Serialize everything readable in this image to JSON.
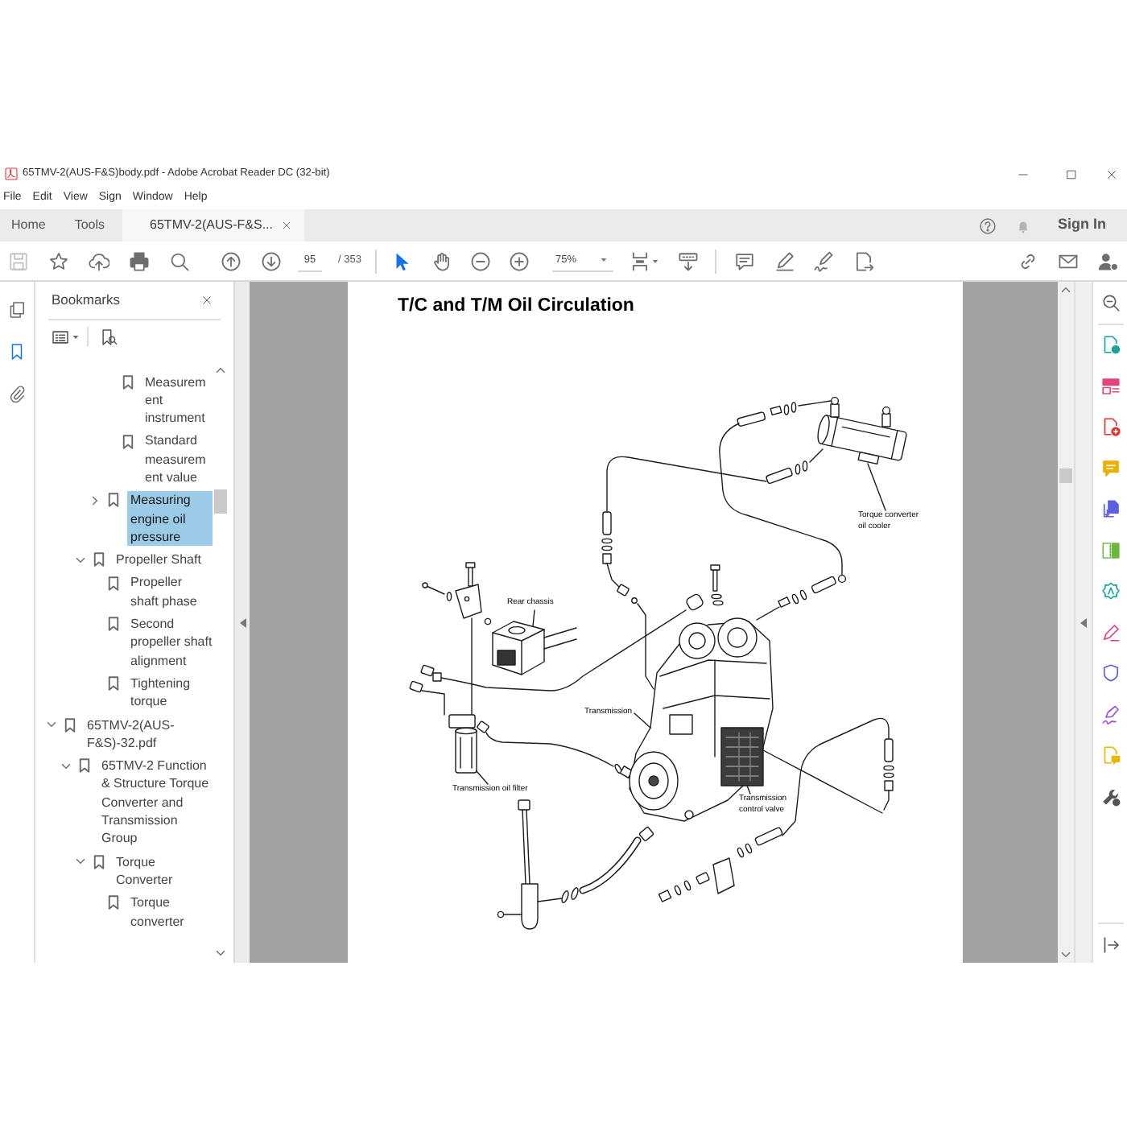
{
  "window": {
    "title": "65TMV-2(AUS-F&S)body.pdf - Adobe Acrobat Reader DC (32-bit)"
  },
  "menu": [
    "File",
    "Edit",
    "View",
    "Sign",
    "Window",
    "Help"
  ],
  "tabs": [
    {
      "label": "Home",
      "selected": false,
      "closable": false
    },
    {
      "label": "Tools",
      "selected": false,
      "closable": false
    },
    {
      "label": "65TMV-2(AUS-F&S...",
      "selected": true,
      "closable": true
    }
  ],
  "header_actions": {
    "sign_in": "Sign In"
  },
  "toolbar": {
    "save_button": {
      "disabled": true
    },
    "page_field": "95",
    "page_count": "/ 353",
    "tools": [
      {
        "kind": "select",
        "selected": true
      },
      {
        "kind": "hand",
        "selected": false
      }
    ],
    "zoom_field": "75%"
  },
  "left_rail": [
    {
      "kind": "pages",
      "selected": false
    },
    {
      "kind": "bookmarks",
      "selected": true
    },
    {
      "kind": "attachments",
      "selected": false
    }
  ],
  "bookmarks_panel": {
    "title": "Bookmarks",
    "tree": [
      {
        "children": [
          {
            "children": [
              {
                "children": [
                  {
                    "children": [
                      {
                        "label": "Measurement instrument",
                        "kind": "leaf",
                        "selected": false
                      },
                      {
                        "label": "Standard measurement value",
                        "kind": "leaf",
                        "selected": false
                      }
                    ]
                  },
                  {
                    "label": "Measuring engine oil pressure",
                    "kind": "branch",
                    "expanded": false,
                    "selected": true
                  }
                ]
              },
              {
                "label": "Propeller Shaft",
                "kind": "branch",
                "expanded": true,
                "selected": false,
                "children": [
                  {
                    "label": "Propeller shaft phase",
                    "kind": "leaf",
                    "selected": false
                  },
                  {
                    "label": "Second propeller shaft alignment",
                    "kind": "leaf",
                    "selected": false
                  },
                  {
                    "label": "Tightening torque",
                    "kind": "leaf",
                    "selected": false
                  }
                ]
              }
            ]
          }
        ]
      },
      {
        "label": "65TMV-2(AUS-F&S)-32.pdf",
        "kind": "branch",
        "expanded": true,
        "selected": false,
        "children": [
          {
            "label": "65TMV-2 Function & Structure Torque Converter and Transmission Group",
            "kind": "branch",
            "expanded": true,
            "selected": false,
            "children": [
              {
                "label": "Torque Converter",
                "kind": "branch",
                "expanded": true,
                "selected": false,
                "children": [
                  {
                    "label": "Torque converter",
                    "kind": "leaf",
                    "selected": false
                  }
                ]
              }
            ]
          }
        ]
      }
    ]
  },
  "document": {
    "title": "T/C and T/M Oil Circulation",
    "callouts": {
      "oil_cooler": "Torque converter oil cooler",
      "rear_chassis": "Rear chassis",
      "transmission": "Transmission",
      "oil_filter": "Transmission oil filter",
      "control_valve": "Transmission control valve"
    }
  }
}
